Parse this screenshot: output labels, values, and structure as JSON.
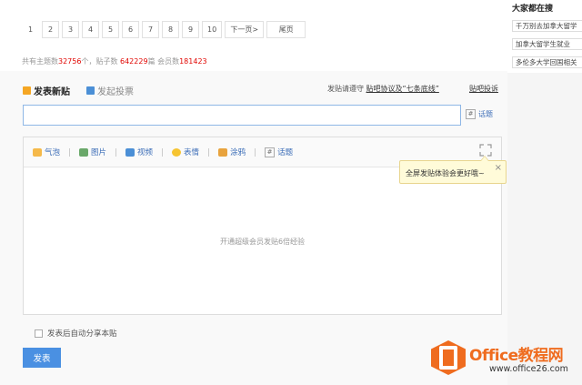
{
  "pager": {
    "pages": [
      "1",
      "2",
      "3",
      "4",
      "5",
      "6",
      "7",
      "8",
      "9",
      "10"
    ],
    "next": "下一页>",
    "last": "尾页"
  },
  "stats": {
    "topics_label": "共有主题数",
    "topics_value": "32756",
    "topics_unit": "个，贴子数 ",
    "posts_value": "642229",
    "posts_unit": "篇 ",
    "members_label": "会员数",
    "members_value": "181423"
  },
  "sidebar": {
    "title": "大家都在搜",
    "items": [
      "千万别去加拿大留学",
      "加拿大留学生就业",
      "多伦多大学回国相关"
    ]
  },
  "post": {
    "title": "发表新贴",
    "vote": "发起投票",
    "rules_prefix": "发贴请遵守 ",
    "rules_link": "贴吧协议及“七条底线”",
    "complain": "贴吧投诉",
    "topic_label": "话题",
    "title_value": ""
  },
  "toolbar": {
    "items": [
      {
        "label": "气泡",
        "icon": "bubble-icon",
        "color": "#f5b94a"
      },
      {
        "label": "图片",
        "icon": "image-icon",
        "color": "#6aa86a"
      },
      {
        "label": "视频",
        "icon": "video-icon",
        "color": "#4b8fd6"
      },
      {
        "label": "表情",
        "icon": "smiley-icon",
        "color": "#f6c431"
      },
      {
        "label": "涂鸦",
        "icon": "brush-icon",
        "color": "#e8a33d"
      },
      {
        "label": "话题",
        "icon": "hash-icon",
        "color": "#8aa4c8"
      }
    ]
  },
  "editor": {
    "placeholder": "开通超级会员发贴6倍经验"
  },
  "tooltip": {
    "text": "全屏发贴体验会更好哦~",
    "close": "×"
  },
  "footer": {
    "share_label": "发表后自动分享本贴",
    "submit": "发表"
  },
  "watermark": {
    "brand": "Office教程网",
    "url": "www.office26.com",
    "color": "#ef6c1f"
  }
}
